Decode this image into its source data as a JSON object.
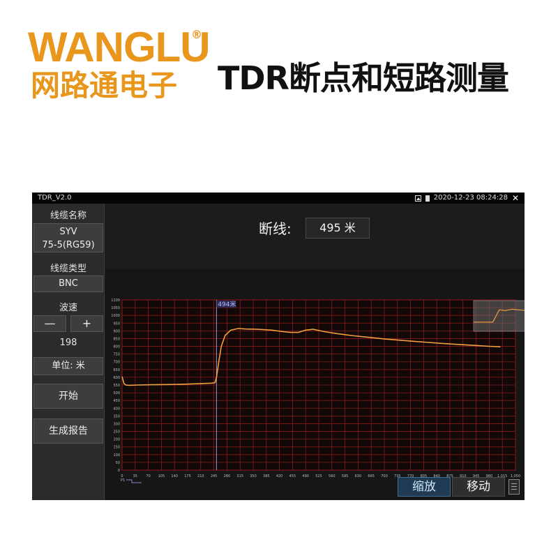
{
  "brand": {
    "name": "WANGLU",
    "registered_mark": "®",
    "chinese_name": "网路通电子"
  },
  "page_title": "TDR断点和短路测量",
  "device": {
    "app_title": "TDR_V2.0",
    "datetime": "2020-12-23 08:24:28",
    "status_icons": [
      "image-icon",
      "battery-icon",
      "close-icon"
    ],
    "sidebar": {
      "cable_name_label": "线缆名称",
      "cable_name_line1": "SYV",
      "cable_name_line2": "75-5(RG59)",
      "cable_type_label": "线缆类型",
      "cable_type_value": "BNC",
      "velocity_label": "波速",
      "minus_label": "—",
      "plus_label": "+",
      "velocity_value": "198",
      "unit_label": "单位: 米",
      "start_label": "开始",
      "report_label": "生成报告"
    },
    "readout": {
      "label": "断线:",
      "value": "495 米"
    },
    "modes": {
      "zoom_label": "缩放",
      "move_label": "移动"
    },
    "colors": {
      "grid": "#8b1a1a",
      "trace": "#f0a040",
      "cursor": "#9a9ad0",
      "zoom_active": "#1f3a52"
    }
  },
  "chart_data": {
    "type": "line",
    "title": "",
    "xlabel": "",
    "ylabel": "",
    "xlim": [
      0,
      1050
    ],
    "ylim": [
      0,
      1100
    ],
    "x_ticks": [
      0,
      35,
      70,
      105,
      140,
      175,
      210,
      245,
      280,
      315,
      350,
      385,
      420,
      455,
      490,
      525,
      560,
      595,
      630,
      665,
      700,
      735,
      770,
      805,
      840,
      875,
      910,
      945,
      980,
      1015,
      1050
    ],
    "x_tick_labels": [
      "0",
      "35",
      "70",
      "105",
      "140",
      "175",
      "210",
      "245",
      "280",
      "315",
      "350",
      "385",
      "420",
      "455",
      "490",
      "525",
      "560",
      "595",
      "630",
      "665",
      "700",
      "735",
      "770",
      "805",
      "840",
      "875",
      "910",
      "945",
      "980",
      "1,015",
      "1,050"
    ],
    "y_ticks": [
      0,
      50,
      100,
      150,
      200,
      250,
      300,
      350,
      400,
      450,
      500,
      550,
      600,
      650,
      700,
      750,
      800,
      850,
      900,
      950,
      1000,
      1050,
      1100
    ],
    "grid": true,
    "cursor": {
      "x": 252,
      "label": "494米"
    },
    "series": [
      {
        "x": [
          0,
          5,
          10,
          20,
          40,
          80,
          120,
          160,
          200,
          240,
          248,
          252,
          258,
          265,
          275,
          290,
          310,
          330,
          360,
          400,
          430,
          450,
          470,
          490,
          510,
          540,
          580,
          620,
          660,
          700,
          740,
          780,
          820,
          860,
          900,
          940,
          980,
          1010
        ],
        "y": [
          605,
          560,
          550,
          548,
          550,
          552,
          553,
          555,
          558,
          562,
          565,
          600,
          700,
          800,
          870,
          905,
          915,
          912,
          910,
          905,
          895,
          890,
          890,
          905,
          910,
          895,
          880,
          868,
          858,
          848,
          840,
          832,
          825,
          818,
          812,
          806,
          800,
          797
        ]
      }
    ],
    "inset": {
      "x": [
        0,
        10,
        20,
        30,
        40,
        50,
        55,
        60,
        70,
        80,
        90,
        100
      ],
      "y": [
        30,
        30,
        30,
        30,
        70,
        68,
        70,
        72,
        70,
        68,
        66,
        64
      ]
    },
    "legend_marker": "P1"
  }
}
